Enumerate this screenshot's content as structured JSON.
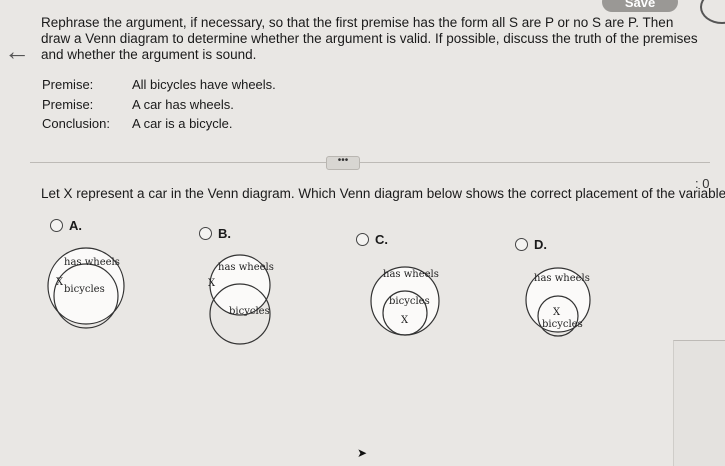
{
  "header": {
    "save_label": "Save"
  },
  "problem": {
    "instructions": "Rephrase the argument, if necessary, so that the first premise has the form all S are P or no S are P. Then draw a Venn diagram to determine whether the argument is valid. If possible, discuss the truth of the premises and whether the argument is sound.",
    "rows": [
      {
        "label": "Premise:",
        "text": "All bicycles have wheels."
      },
      {
        "label": "Premise:",
        "text": "A car has wheels."
      },
      {
        "label": "Conclusion:",
        "text": "A car is a bicycle."
      }
    ]
  },
  "divider": {
    "dots_label": "•••",
    "counter": ": 0"
  },
  "question": {
    "text": "Let X represent a car in the Venn diagram. Which Venn diagram below shows the correct placement of the variable X?"
  },
  "options": [
    {
      "letter": "A.",
      "outer": "has wheels",
      "inner": "bicycles",
      "x": "X"
    },
    {
      "letter": "B.",
      "outer": "has wheels",
      "inner": "bicycles",
      "x": "X"
    },
    {
      "letter": "C.",
      "outer": "has wheels",
      "inner": "bicycles",
      "x": "X"
    },
    {
      "letter": "D.",
      "outer": "has wheels",
      "inner": "bicycles",
      "x": "X"
    }
  ]
}
